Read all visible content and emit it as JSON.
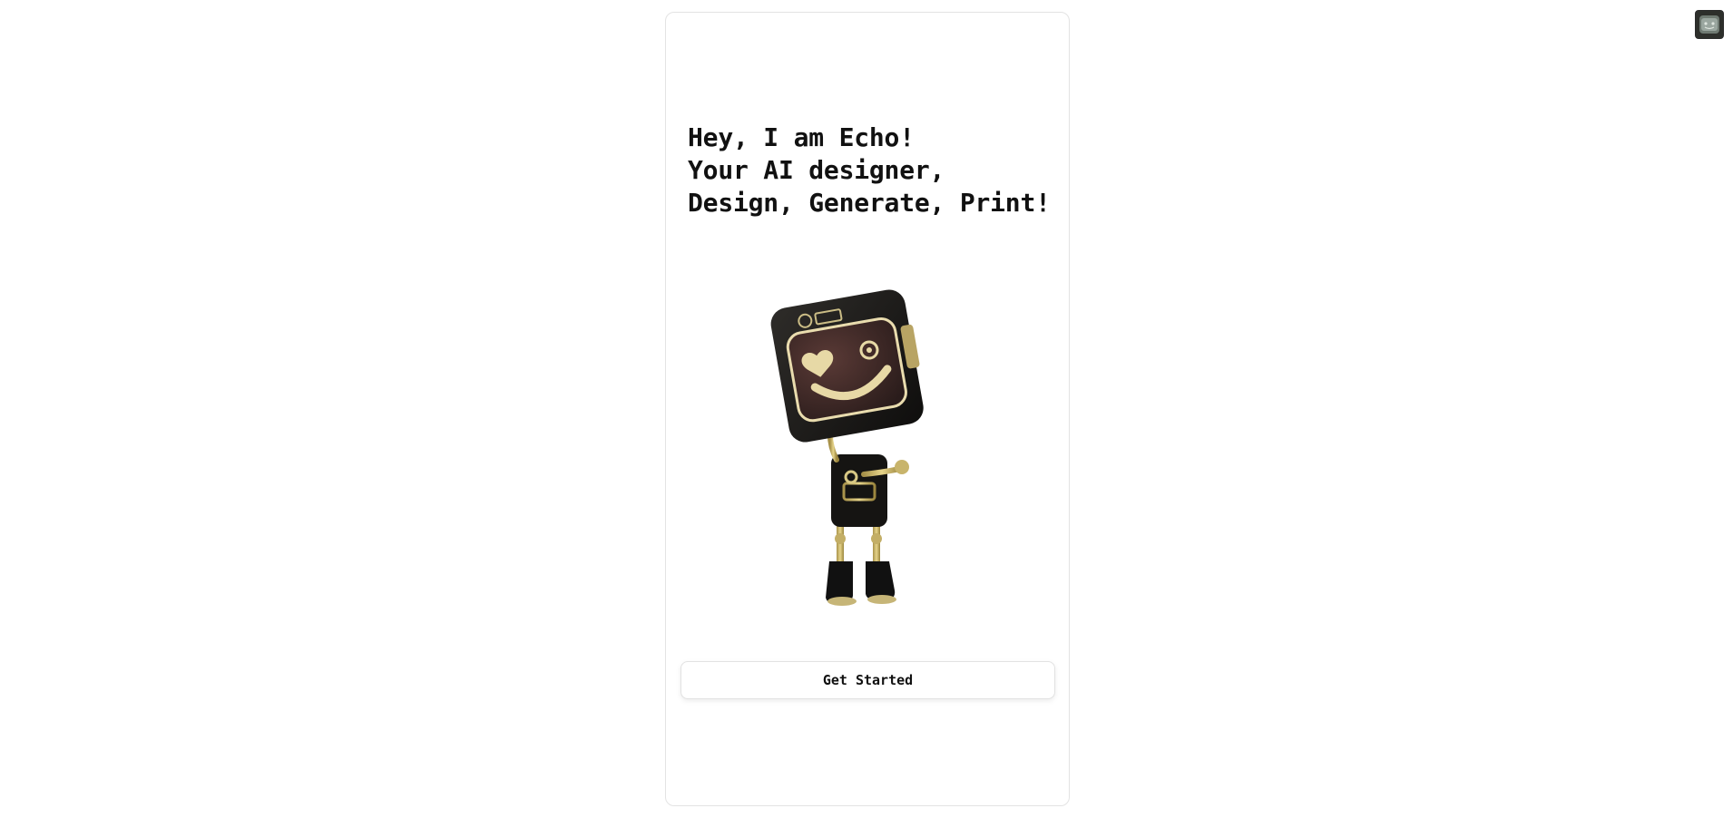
{
  "hero": {
    "lines": [
      "Hey, I am Echo!",
      "Your AI designer,",
      "Design, Generate, Print!"
    ]
  },
  "illustration": {
    "icon": "robot-mascot",
    "colors": {
      "body": "#1b1a18",
      "screen": "#3b2a28",
      "glow": "#e9dcae",
      "accent": "#c9b56a"
    }
  },
  "cta": {
    "label": "Get Started"
  },
  "profile": {
    "icon": "avatar-icon"
  }
}
